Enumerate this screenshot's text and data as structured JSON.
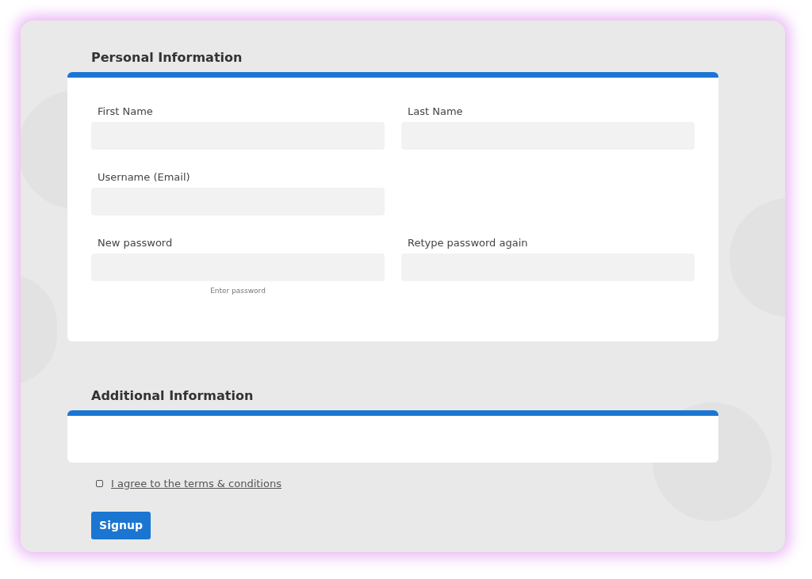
{
  "personal_information": {
    "title": "Personal Information",
    "rows": [
      [
        {
          "label": "First Name"
        },
        {
          "label": "Last Name"
        }
      ],
      [
        {
          "label": "Username (Email)"
        }
      ],
      [
        {
          "label": "New password",
          "hint": "Enter password"
        },
        {
          "label": "Retype password again"
        }
      ]
    ]
  },
  "additional_information": {
    "title": "Additional Information"
  },
  "terms": {
    "label": "I agree to the terms & conditions",
    "checked": false
  },
  "button": "Signup"
}
